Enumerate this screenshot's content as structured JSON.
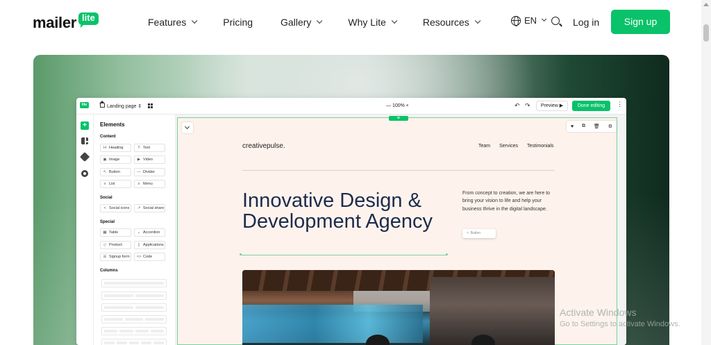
{
  "brand": {
    "word": "mailer",
    "badge": "lite",
    "accent": "#09c269"
  },
  "nav": {
    "items": [
      {
        "label": "Features",
        "dropdown": true
      },
      {
        "label": "Pricing",
        "dropdown": false
      },
      {
        "label": "Gallery",
        "dropdown": true
      },
      {
        "label": "Why Lite",
        "dropdown": true
      },
      {
        "label": "Resources",
        "dropdown": true
      }
    ],
    "language": "EN",
    "login": "Log in",
    "signup": "Sign up"
  },
  "editor": {
    "badge": "lite",
    "page_selector": "Landing page ⇕",
    "zoom": "—   100%   +",
    "undo": "↶",
    "redo": "↷",
    "preview": "Preview ▶",
    "done": "Done editing",
    "more": "⋮",
    "panel": {
      "title": "Elements",
      "sections": {
        "content": "Content",
        "social": "Social",
        "special": "Special",
        "columns": "Columns"
      },
      "content_items": [
        {
          "icon": "H",
          "label": "Heading"
        },
        {
          "icon": "T",
          "label": "Text"
        },
        {
          "icon": "▣",
          "label": "Image"
        },
        {
          "icon": "▶",
          "label": "Video"
        },
        {
          "icon": "↖",
          "label": "Button"
        },
        {
          "icon": "—",
          "label": "Divider"
        },
        {
          "icon": "≡",
          "label": "List"
        },
        {
          "icon": "≡",
          "label": "Menu"
        }
      ],
      "social_items": [
        {
          "icon": "<",
          "label": "Social icons"
        },
        {
          "icon": "↗",
          "label": "Social share"
        }
      ],
      "special_items": [
        {
          "icon": "▦",
          "label": "Table"
        },
        {
          "icon": "⌄",
          "label": "Accordion"
        },
        {
          "icon": "◇",
          "label": "Product"
        },
        {
          "icon": "▯",
          "label": "Applications"
        },
        {
          "icon": "☰",
          "label": "Signup form"
        },
        {
          "icon": "<>",
          "label": "Code"
        }
      ]
    },
    "canvas": {
      "tab": "⊕",
      "tools": [
        "♥",
        "⧉",
        "🗑",
        "⚙"
      ],
      "brand": "creativepulse.",
      "links": [
        "Team",
        "Services",
        "Testimonials"
      ],
      "headline": "Innovative Design & Development Agency",
      "paragraph": "From concept to creation, we are here to bring your vision to life and help your business thrive in the digital landscape.",
      "button": "↖ Button"
    }
  },
  "watermark": {
    "title": "Activate Windows",
    "subtitle": "Go to Settings to activate Windows."
  }
}
